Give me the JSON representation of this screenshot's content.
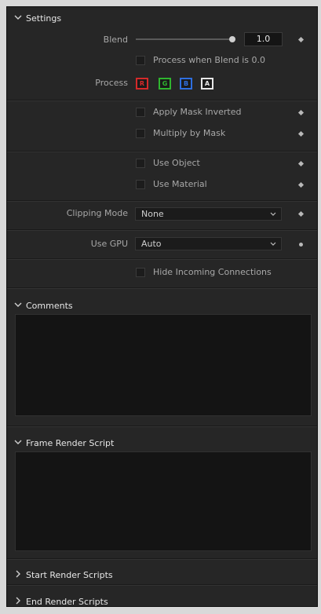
{
  "settings": {
    "title": "Settings",
    "blend_label": "Blend",
    "blend_value": "1.0",
    "blend_fraction": 1.0,
    "process_when_blend_zero": "Process when Blend is 0.0",
    "process_label": "Process",
    "channels": [
      {
        "letter": "R",
        "color": "#d42a2a"
      },
      {
        "letter": "G",
        "color": "#2fb52f"
      },
      {
        "letter": "B",
        "color": "#2f6fe0"
      },
      {
        "letter": "A",
        "color": "#e6e6e6"
      }
    ],
    "apply_mask_inverted": "Apply Mask Inverted",
    "multiply_by_mask": "Multiply by Mask",
    "use_object": "Use Object",
    "use_material": "Use Material",
    "clipping_mode_label": "Clipping Mode",
    "clipping_mode_value": "None",
    "use_gpu_label": "Use GPU",
    "use_gpu_value": "Auto",
    "hide_incoming": "Hide Incoming Connections"
  },
  "comments": {
    "title": "Comments"
  },
  "frame_render_script": {
    "title": "Frame Render Script"
  },
  "start_render_scripts": {
    "title": "Start Render Scripts"
  },
  "end_render_scripts": {
    "title": "End Render Scripts"
  }
}
